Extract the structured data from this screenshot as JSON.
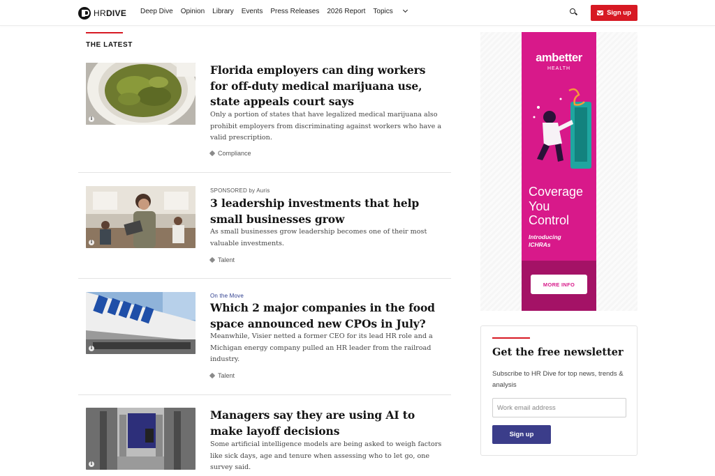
{
  "header": {
    "logo_hr": "HR",
    "logo_dive": "DIVE",
    "nav": [
      "Deep Dive",
      "Opinion",
      "Library",
      "Events",
      "Press Releases",
      "2026 Report",
      "Topics"
    ],
    "signup_label": "Sign up"
  },
  "section": {
    "title": "THE LATEST"
  },
  "articles": [
    {
      "kicker": "",
      "headline": "Florida employers can ding workers for off-duty medical marijuana use, state appeals court says",
      "dek": "Only a portion of states that have legalized medical marijuana also prohibit employers from discriminating against workers who have a valid prescription.",
      "tag": "Compliance"
    },
    {
      "kicker_prefix": "SPONSORED",
      "kicker_by": "by Auris",
      "headline": "3 leadership investments that help small businesses grow",
      "dek": "As small businesses grow leadership becomes one of their most valuable investments.",
      "tag": "Talent"
    },
    {
      "kicker": "On the Move",
      "headline": "Which 2 major companies in the food space announced new CPOs in July?",
      "dek": "Meanwhile, Visier netted a former CEO for its lead HR role and a Michigan energy company pulled an HR leader from the railroad industry.",
      "tag": "Talent"
    },
    {
      "kicker": "",
      "headline": "Managers say they are using AI to make layoff decisions",
      "dek": "Some artificial intelligence models are being asked to weigh factors like sick days, age and tenure when assessing who to let go, one survey said.",
      "tag": ""
    }
  ],
  "ad": {
    "brand": "ambetter",
    "brand_sub": "HEALTH",
    "headline_lines": [
      "Coverage",
      "You",
      "Control"
    ],
    "intro_lines": [
      "Introducing",
      "ICHRAs"
    ],
    "cta": "MORE INFO",
    "colors": {
      "background": "#d8198a",
      "footer": "#a41266"
    }
  },
  "newsletter": {
    "title": "Get the free newsletter",
    "description": "Subscribe to HR Dive for top news, trends & analysis",
    "input_placeholder": "Work email address",
    "button_label": "Sign up"
  },
  "colors": {
    "accent_red": "#d71923",
    "button_indigo": "#3b3d8a",
    "kicker_blue": "#2d3d8e"
  }
}
